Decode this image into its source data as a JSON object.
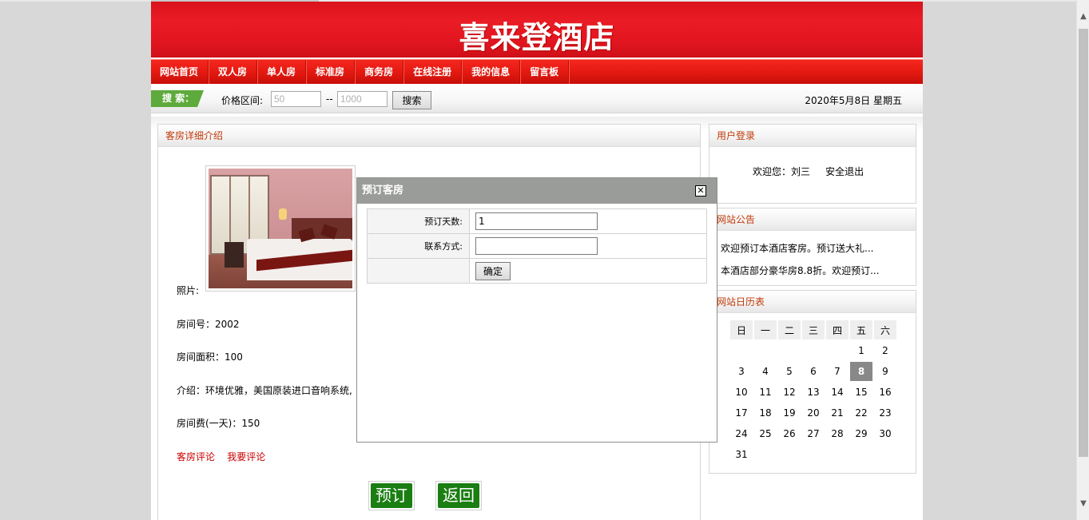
{
  "site": {
    "title": "喜来登酒店"
  },
  "nav": [
    "网站首页",
    "双人房",
    "单人房",
    "标准房",
    "商务房",
    "在线注册",
    "我的信息",
    "留言板"
  ],
  "search": {
    "tag": "搜 索：",
    "price_label": "价格区间:",
    "min_placeholder": "50",
    "max_placeholder": "1000",
    "dash": "--",
    "button": "搜索",
    "date": "2020年5月8日 星期五"
  },
  "detail": {
    "heading": "客房详细介绍",
    "photo_label": "照片:",
    "room_no": "房间号：2002",
    "area": "房间面积：100",
    "intro": "介绍：环境优雅，美国原装进口音响系统,",
    "price": "房间费(一天)：150",
    "review_link": "客房评论",
    "write_review_link": "我要评论",
    "book_button": "预订",
    "back_button": "返回"
  },
  "login": {
    "heading": "用户登录",
    "welcome": "欢迎您：刘三",
    "logout": "安全退出"
  },
  "notice": {
    "heading": "网站公告",
    "items": [
      "欢迎预订本酒店客房。预订送大礼...",
      "本酒店部分豪华房8.8折。欢迎预订..."
    ]
  },
  "calendar": {
    "heading": "网站日历表",
    "weekdays": [
      "日",
      "一",
      "二",
      "三",
      "四",
      "五",
      "六"
    ],
    "weeks": [
      [
        "",
        "",
        "",
        "",
        "",
        "1",
        "2"
      ],
      [
        "3",
        "4",
        "5",
        "6",
        "7",
        "8",
        "9"
      ],
      [
        "10",
        "11",
        "12",
        "13",
        "14",
        "15",
        "16"
      ],
      [
        "17",
        "18",
        "19",
        "20",
        "21",
        "22",
        "23"
      ],
      [
        "24",
        "25",
        "26",
        "27",
        "28",
        "29",
        "30"
      ],
      [
        "31",
        "",
        "",
        "",
        "",
        "",
        ""
      ]
    ],
    "today": "8"
  },
  "modal": {
    "title": "预订客房",
    "close_icon": "close-icon",
    "days_label": "预订天数:",
    "days_value": "1",
    "contact_label": "联系方式:",
    "contact_value": "",
    "confirm": "确定"
  }
}
